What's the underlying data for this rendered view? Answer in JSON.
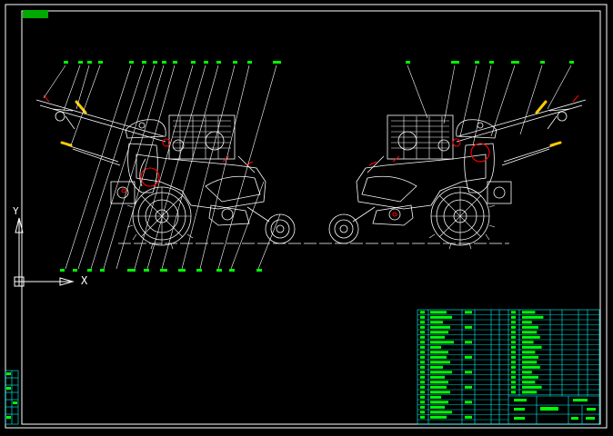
{
  "drawing": {
    "tag_label": "",
    "axis_x_label": "X",
    "axis_y_label": "Y"
  },
  "colors": {
    "background": "#000000",
    "frame": "#ffffff",
    "machine": "#ffffff",
    "leader": "#ffffff",
    "balloon": "#00ff00",
    "table_line": "#00ffff",
    "table_text": "#00ff00",
    "accent_red": "#ff0000",
    "accent_yellow": "#ffcc00"
  }
}
